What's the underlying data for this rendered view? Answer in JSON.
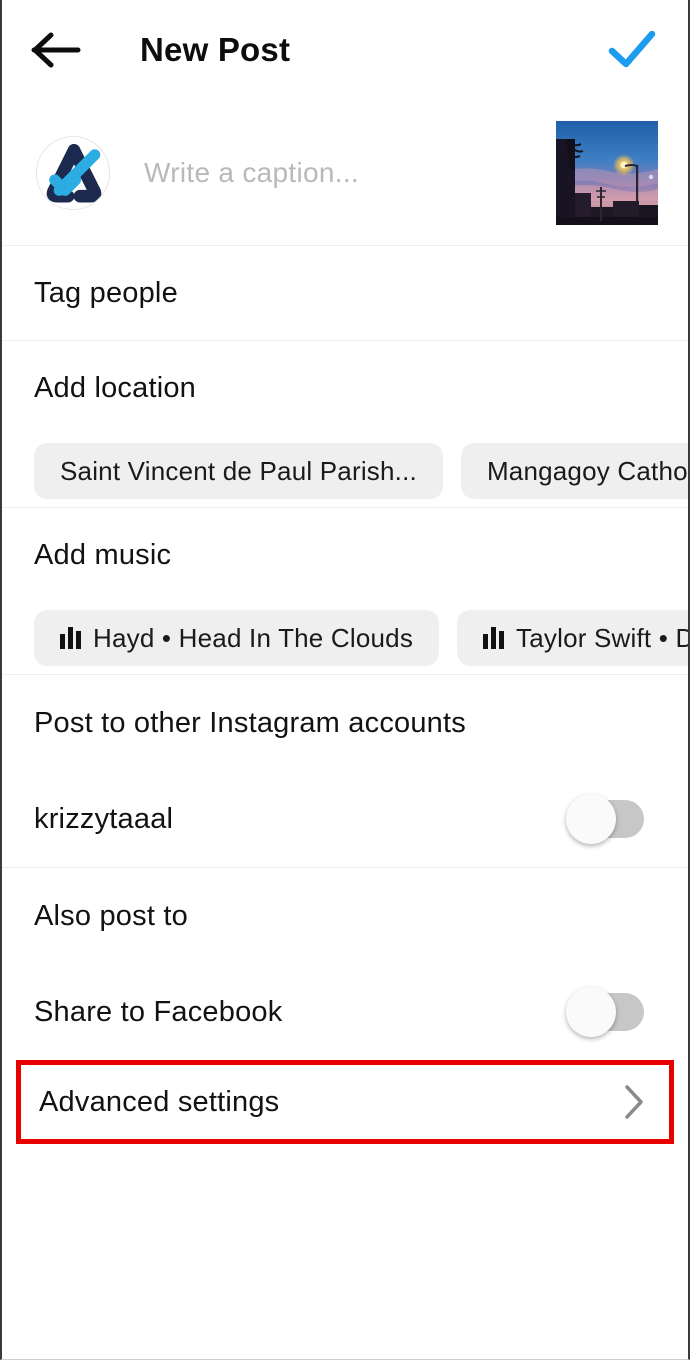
{
  "header": {
    "back_icon": "arrow-left-icon",
    "title": "New Post",
    "confirm_icon": "check-icon",
    "accent_color": "#1c9cef"
  },
  "caption": {
    "avatar_alt": "user-avatar",
    "placeholder": "Write a caption...",
    "thumbnail_alt": "post-thumbnail"
  },
  "rows": {
    "tag_people": "Tag people",
    "add_location": "Add location",
    "add_music": "Add music",
    "advanced_settings": "Advanced settings"
  },
  "location_suggestions": [
    {
      "label": "Saint Vincent de Paul Parish..."
    },
    {
      "label": "Mangagoy  Catholic Church"
    }
  ],
  "music_suggestions": [
    {
      "icon": "music-bars-icon",
      "label": "Hayd • Head In The Clouds"
    },
    {
      "icon": "music-bars-icon",
      "label": "Taylor Swift • Daylight"
    }
  ],
  "other_accounts": {
    "title": "Post to other Instagram accounts",
    "accounts": [
      {
        "name": "krizzytaaal",
        "enabled": false
      }
    ]
  },
  "also_post_to": {
    "title": "Also post to",
    "targets": [
      {
        "name": "Share to Facebook",
        "enabled": false
      }
    ]
  },
  "highlight": {
    "color": "#e60000",
    "target": "Advanced settings"
  },
  "colors": {
    "background": "#ffffff",
    "text": "#121212",
    "placeholder": "#b9b9b9",
    "chip_background": "#efefef",
    "divider": "#efefef",
    "toggle_off_track": "#c7c7c7"
  }
}
